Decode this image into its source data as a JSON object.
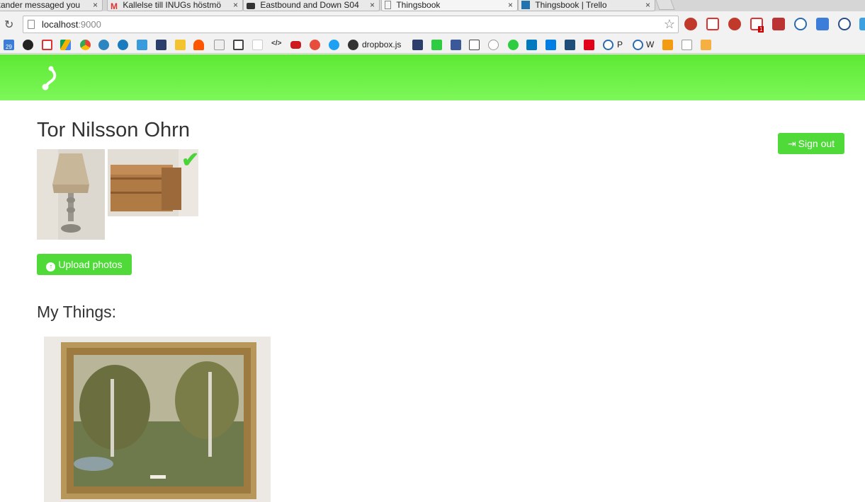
{
  "browser": {
    "tabs": [
      {
        "title": "xander messaged you",
        "favicon": "chat-icon"
      },
      {
        "title": "Kallelse till INUGs höstmö",
        "favicon": "gmail-icon"
      },
      {
        "title": "Eastbound and Down S04",
        "favicon": "car-icon"
      },
      {
        "title": "Thingsbook",
        "favicon": "page-icon"
      },
      {
        "title": "Thingsbook | Trello",
        "favicon": "trello-icon"
      }
    ],
    "close_glyph": "×",
    "url_host": "localhost",
    "url_port": ":9000",
    "bookmark_text_dropbox": "dropbox.js",
    "bookmark_text_p": "P",
    "bookmark_text_w": "W",
    "calendar_day": "29",
    "gmail_badge": "1"
  },
  "app": {
    "header_color": "#6cf048",
    "accent": "#50da3a",
    "user_name": "Tor Nilsson Ohrn",
    "sign_out_label": "Sign out",
    "upload_label": "Upload photos",
    "my_things_title": "My Things:"
  }
}
